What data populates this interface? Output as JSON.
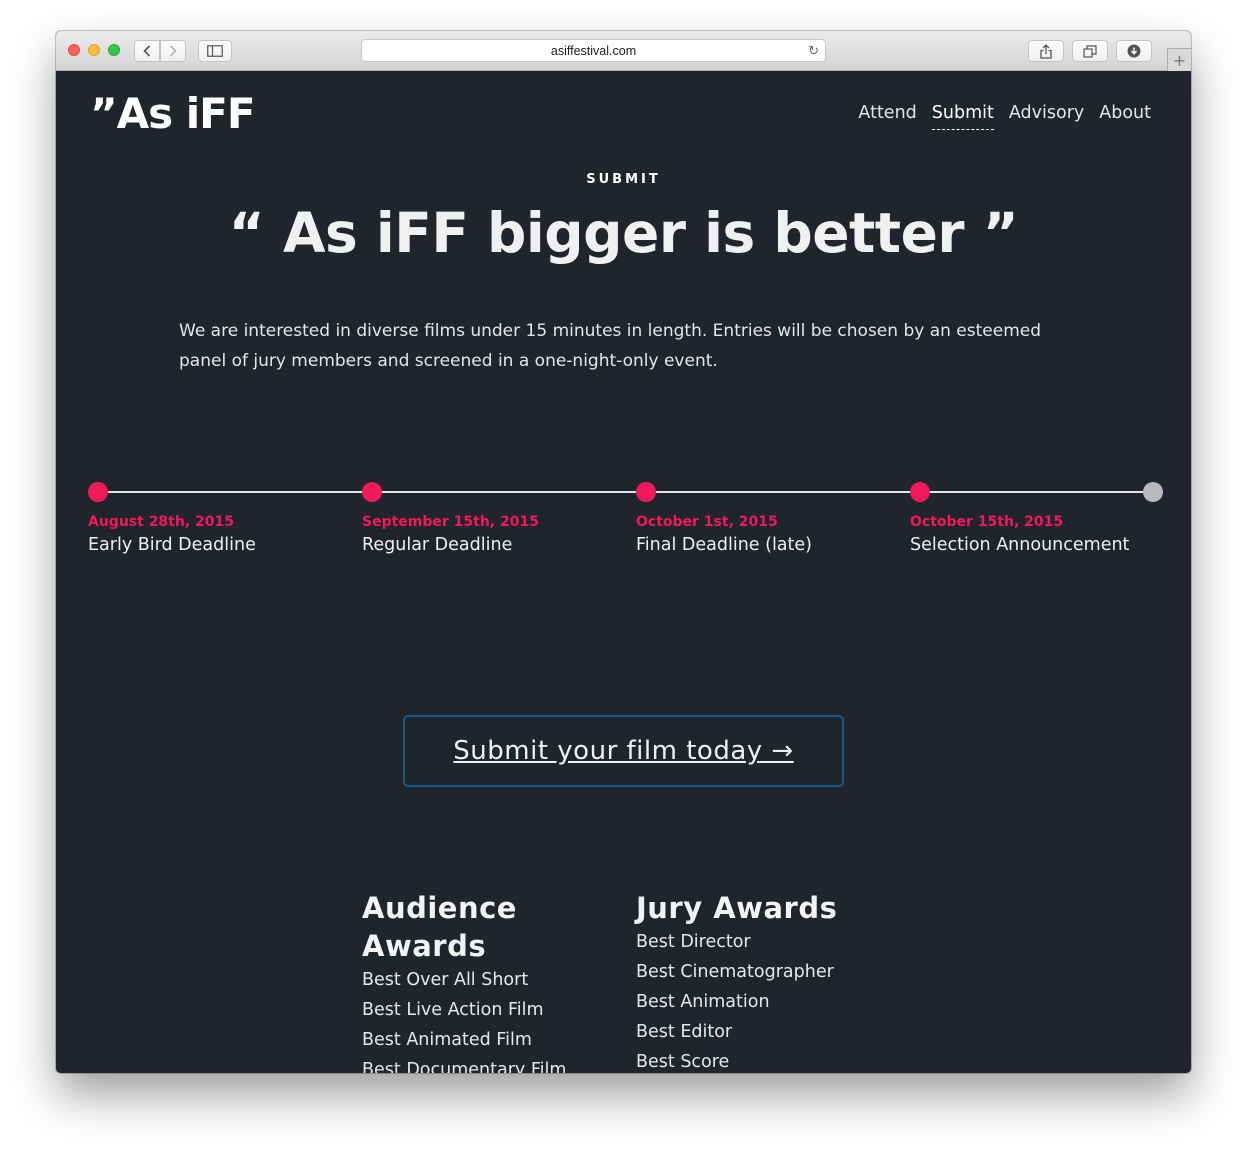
{
  "browser": {
    "url": "asiffestival.com"
  },
  "site": {
    "logo": "”As iFF"
  },
  "nav": {
    "items": [
      {
        "label": "Attend"
      },
      {
        "label": "Submit"
      },
      {
        "label": "Advisory"
      },
      {
        "label": "About"
      }
    ],
    "active": "Submit"
  },
  "hero": {
    "eyebrow": "SUBMIT",
    "headline": "“ As iFF bigger is better ”",
    "intro": "We are interested in diverse films under 15 minutes in length. Entries will be chosen by an esteemed panel of jury members and screened in a one-night-only event."
  },
  "timeline": [
    {
      "date": "August 28th, 2015",
      "label": "Early Bird Deadline"
    },
    {
      "date": "September 15th, 2015",
      "label": "Regular Deadline"
    },
    {
      "date": "October 1st, 2015",
      "label": "Final Deadline (late)"
    },
    {
      "date": "October 15th, 2015",
      "label": "Selection Announcement"
    }
  ],
  "cta": {
    "label": "Submit your film today →"
  },
  "awards": {
    "audience": {
      "title": "Audience Awards",
      "items": [
        "Best Over All Short",
        "Best Live Action Film",
        "Best Animated Film",
        "Best Documentary Film"
      ]
    },
    "jury": {
      "title": "Jury Awards",
      "items": [
        "Best Director",
        "Best Cinematographer",
        "Best Animation",
        "Best Editor",
        "Best Score"
      ]
    }
  },
  "colors": {
    "background": "#1f252b",
    "accent": "#f0195a",
    "cta_border": "#17598f"
  }
}
